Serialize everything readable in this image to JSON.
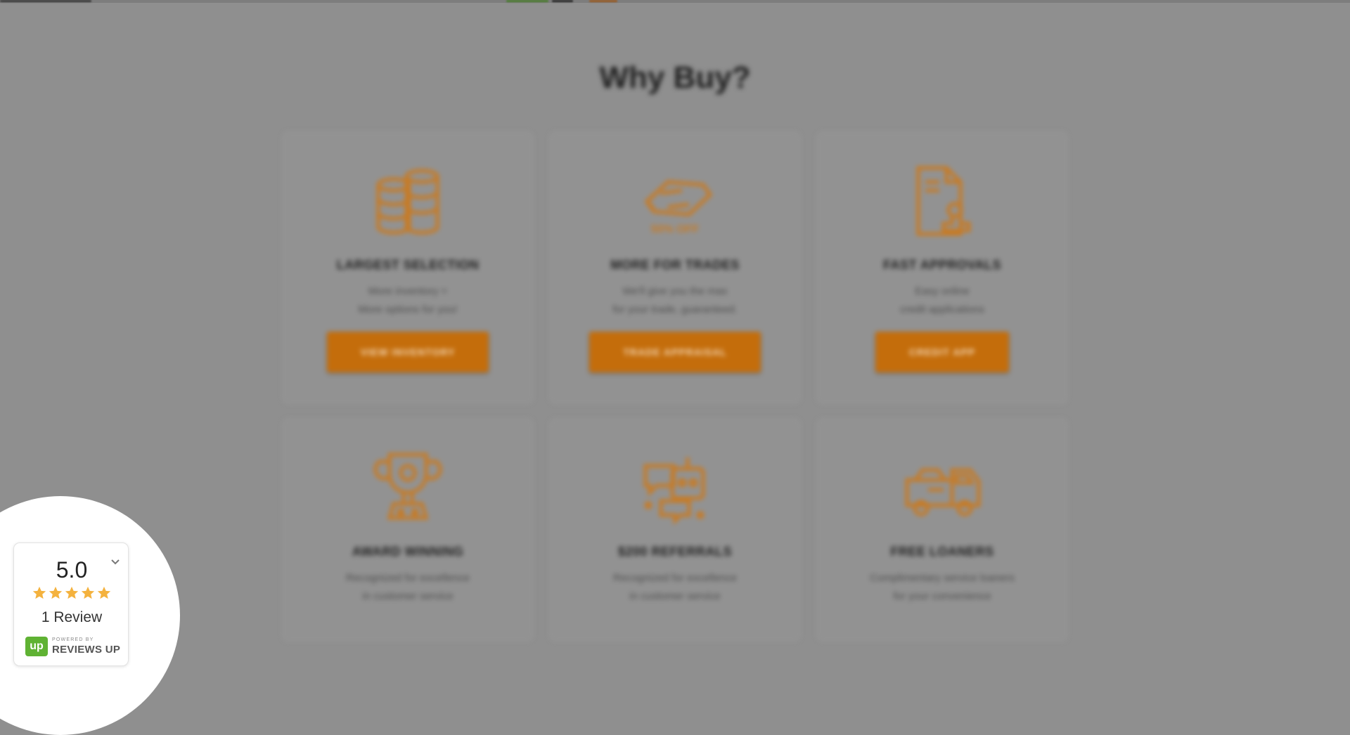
{
  "page": {
    "section_title": "Why Buy?"
  },
  "features": [
    {
      "title": "LARGEST SELECTION",
      "desc_line1": "More inventory =",
      "desc_line2": "More options for you!",
      "cta": "VIEW INVENTORY",
      "icon": "coins-icon"
    },
    {
      "title": "MORE FOR TRADES",
      "desc_line1": "We'll give you the max",
      "desc_line2": "for your trade, guaranteed.",
      "cta": "TRADE APPRAISAL",
      "icon": "percent-off-tag-icon"
    },
    {
      "title": "FAST APPROVALS",
      "desc_line1": "Easy online",
      "desc_line2": "credit applications",
      "cta": "CREDIT APP",
      "icon": "approval-stamp-document-icon"
    },
    {
      "title": "AWARD WINNING",
      "desc_line1": "Recognized for excellence",
      "desc_line2": "in customer service",
      "cta": "",
      "icon": "trophy-icon"
    },
    {
      "title": "$200 REFERRALS",
      "desc_line1": "Recognized for excellence",
      "desc_line2": "in customer service",
      "cta": "",
      "icon": "referral-chat-icon"
    },
    {
      "title": "FREE LOANERS",
      "desc_line1": "Complimentary service loaners",
      "desc_line2": "for your convenience",
      "cta": "",
      "icon": "tow-truck-icon"
    }
  ],
  "reviews_badge": {
    "score": "5.0",
    "stars": 5,
    "count_text": "1 Review",
    "powered_by": "POWERED BY",
    "brand": "REVIEWS UP",
    "logo_text": "up"
  },
  "colors": {
    "accent_orange": "#c46d0b",
    "star_gold": "#f4b23e",
    "overlay_gray": "#8f8f8f",
    "reviews_up_green": "#5fb233"
  }
}
